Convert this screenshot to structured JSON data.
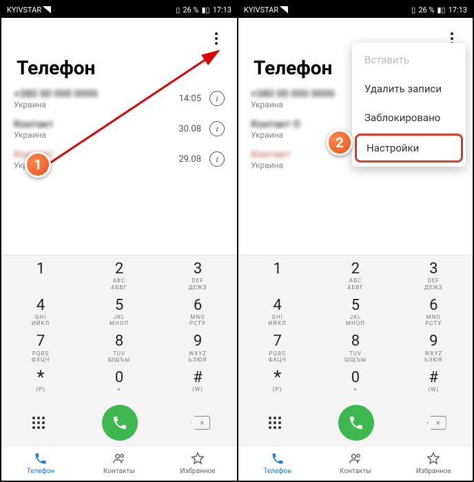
{
  "status": {
    "carrier": "KYIVSTAR",
    "battery": "26 %",
    "time": "17:13"
  },
  "title": "Телефон",
  "calls": [
    {
      "sub": "Украина",
      "time": "14:05",
      "missed": false
    },
    {
      "sub": "Украина",
      "time": "30.08",
      "missed": false
    },
    {
      "sub": "Украина",
      "time": "29.08",
      "missed": true
    }
  ],
  "dialpad": [
    [
      {
        "d": "1",
        "s1": "",
        "s2": ""
      },
      {
        "d": "2",
        "s1": "ABC",
        "s2": "АБВГ"
      },
      {
        "d": "3",
        "s1": "DEF",
        "s2": "ДЕЖЗ"
      }
    ],
    [
      {
        "d": "4",
        "s1": "GHI",
        "s2": "ИЙКЛ"
      },
      {
        "d": "5",
        "s1": "JKL",
        "s2": "МНОП"
      },
      {
        "d": "6",
        "s1": "MNO",
        "s2": "РСТУ"
      }
    ],
    [
      {
        "d": "7",
        "s1": "PQRS",
        "s2": "ФХЦЧ"
      },
      {
        "d": "8",
        "s1": "TUV",
        "s2": "ШЩЪЫ"
      },
      {
        "d": "9",
        "s1": "WXYZ",
        "s2": "ЬЭЮЯ"
      }
    ],
    [
      {
        "d": "*",
        "s1": "(P)",
        "s2": ""
      },
      {
        "d": "0",
        "s1": "+",
        "s2": ""
      },
      {
        "d": "#",
        "s1": "(W)",
        "s2": ""
      }
    ]
  ],
  "nav": {
    "phone": "Телефон",
    "contacts": "Контакты",
    "favorites": "Избранное"
  },
  "menu": {
    "paste": "Вставить",
    "delete": "Удалить записи",
    "blocked": "Заблокировано",
    "settings": "Настройки"
  },
  "markers": {
    "m1": "1",
    "m2": "2"
  }
}
